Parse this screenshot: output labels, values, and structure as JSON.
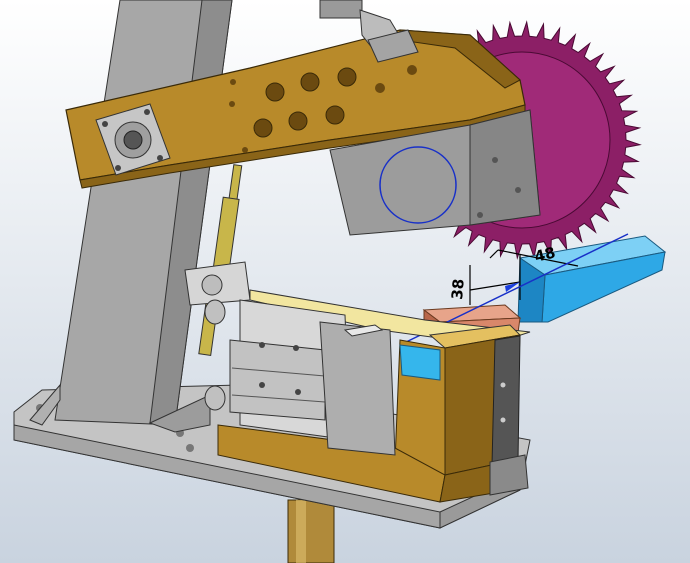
{
  "viewport": {
    "background_top": "#ffffff",
    "background_bottom": "#c9d3df"
  },
  "dimensions": {
    "dim_a": "38",
    "dim_b": "48"
  },
  "colors": {
    "bracket": "#b88a2a",
    "bracket_dark": "#8a6418",
    "base_plate": "#c4c4c4",
    "column": "#a7a7a7",
    "gear": "#8c1f66",
    "motor": "#9c9c9c",
    "guide_rail": "#2ea8e6",
    "workpiece": "#d9876a",
    "rod": "#c8b64a",
    "shaft": "#b08a3a",
    "sketch_line": "#1830c8"
  }
}
